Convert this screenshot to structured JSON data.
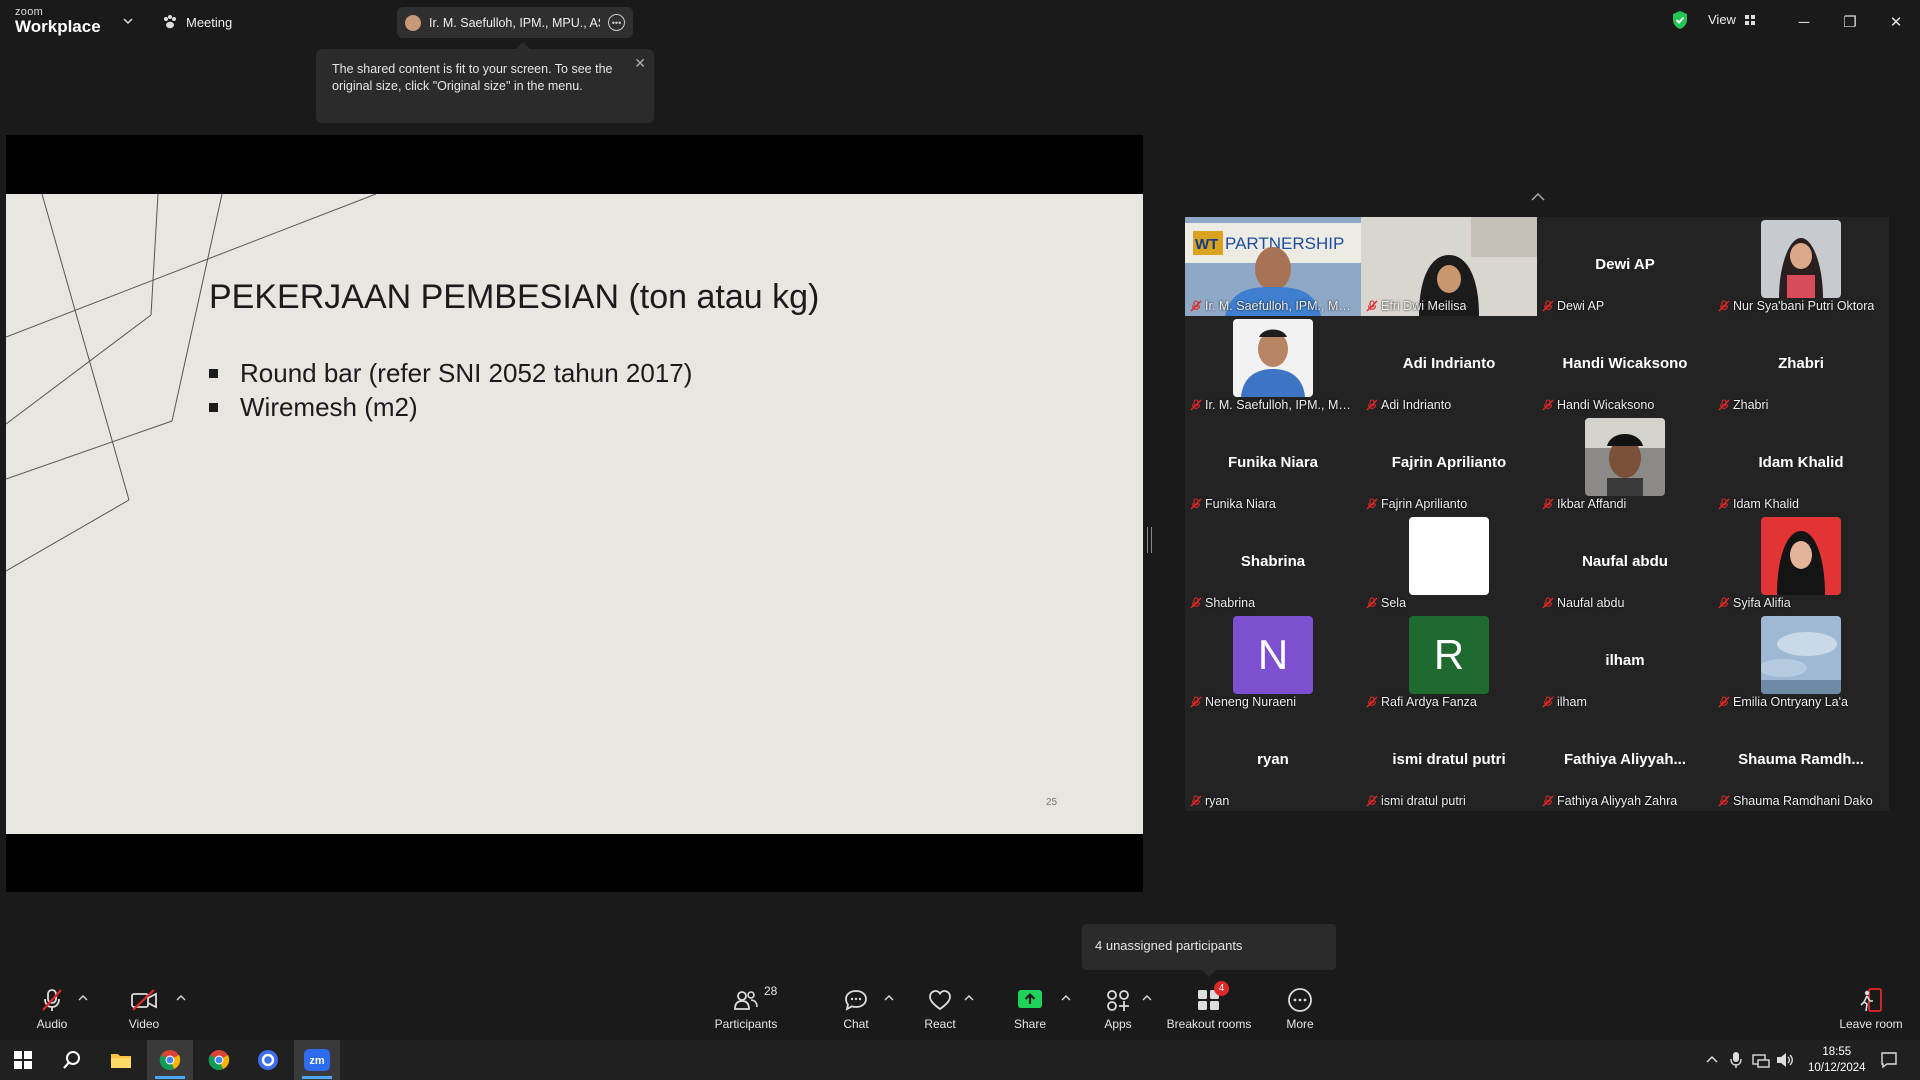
{
  "app": {
    "logo_small": "zoom",
    "logo_big": "Workplace",
    "meeting_label": "Meeting",
    "active_speaker": "Ir. M. Saefulloh, IPM., MPU., ASEAN Eng.",
    "view_label": "View"
  },
  "tooltip": {
    "text": "The shared content is fit to your screen. To see the original size, click \"Original size\" in the menu."
  },
  "slide": {
    "title": "PEKERJAAN PEMBESIAN (ton atau kg)",
    "bullets": [
      "Round bar  (refer SNI 2052 tahun 2017)",
      "Wiremesh (m2)"
    ],
    "page_number": "25"
  },
  "gallery": {
    "tiles": [
      {
        "big": "",
        "label": "Ir. M. Saefulloh, IPM., MPU., ASEAN Eng.",
        "kind": "video-speaker",
        "active": true
      },
      {
        "big": "",
        "label": "Efri Dwi Meilisa",
        "kind": "video-hijab"
      },
      {
        "big": "Dewi AP",
        "label": "Dewi AP",
        "kind": "name"
      },
      {
        "big": "",
        "label": "Nur Sya'bani Putri Oktora",
        "kind": "photo-girl"
      },
      {
        "big": "",
        "label": "Ir. M. Saefulloh, IPM., MPU., ASEAN Eng.",
        "kind": "photo-man"
      },
      {
        "big": "Adi Indrianto",
        "label": "Adi Indrianto",
        "kind": "name"
      },
      {
        "big": "Handi Wicaksono",
        "label": "Handi Wicaksono",
        "kind": "name"
      },
      {
        "big": "Zhabri",
        "label": "Zhabri",
        "kind": "name"
      },
      {
        "big": "Funika Niara",
        "label": "Funika Niara",
        "kind": "name"
      },
      {
        "big": "Fajrin Aprilianto",
        "label": "Fajrin Aprilianto",
        "kind": "name"
      },
      {
        "big": "",
        "label": "Ikbar Affandi",
        "kind": "photo-boy"
      },
      {
        "big": "Idam Khalid",
        "label": "Idam Khalid",
        "kind": "name"
      },
      {
        "big": "Shabrina",
        "label": "Shabrina",
        "kind": "name"
      },
      {
        "big": "",
        "label": "Sela",
        "kind": "photo-white"
      },
      {
        "big": "Naufal abdu",
        "label": "Naufal abdu",
        "kind": "name"
      },
      {
        "big": "",
        "label": "Syifa Alifia",
        "kind": "photo-red"
      },
      {
        "big": "N",
        "label": "Neneng Nuraeni",
        "kind": "letter-purple"
      },
      {
        "big": "R",
        "label": "Rafi Ardya Fanza",
        "kind": "letter-green"
      },
      {
        "big": "ilham",
        "label": "ilham",
        "kind": "name"
      },
      {
        "big": "",
        "label": "Emilia Ontryany La'a",
        "kind": "photo-sky"
      },
      {
        "big": "ryan",
        "label": "ryan",
        "kind": "name"
      },
      {
        "big": "ismi dratul putri",
        "label": "ismi dratul putri",
        "kind": "name"
      },
      {
        "big": "Fathiya  Aliyyah...",
        "label": "Fathiya Aliyyah Zahra",
        "kind": "name"
      },
      {
        "big": "Shauma  Ramdh...",
        "label": "Shauma Ramdhani Dako",
        "kind": "name"
      }
    ]
  },
  "unassigned": "4 unassigned participants",
  "controls": {
    "audio": "Audio",
    "video": "Video",
    "participants": "Participants",
    "participants_count": "28",
    "chat": "Chat",
    "react": "React",
    "share": "Share",
    "apps": "Apps",
    "breakout": "Breakout rooms",
    "breakout_badge": "4",
    "more": "More",
    "leave": "Leave room"
  },
  "colors": {
    "active_speaker_border": "#23d959",
    "share_green": "#1fd35a",
    "muted_red": "#e02828"
  },
  "taskbar": {
    "time": "18:55",
    "date": "10/12/2024"
  }
}
